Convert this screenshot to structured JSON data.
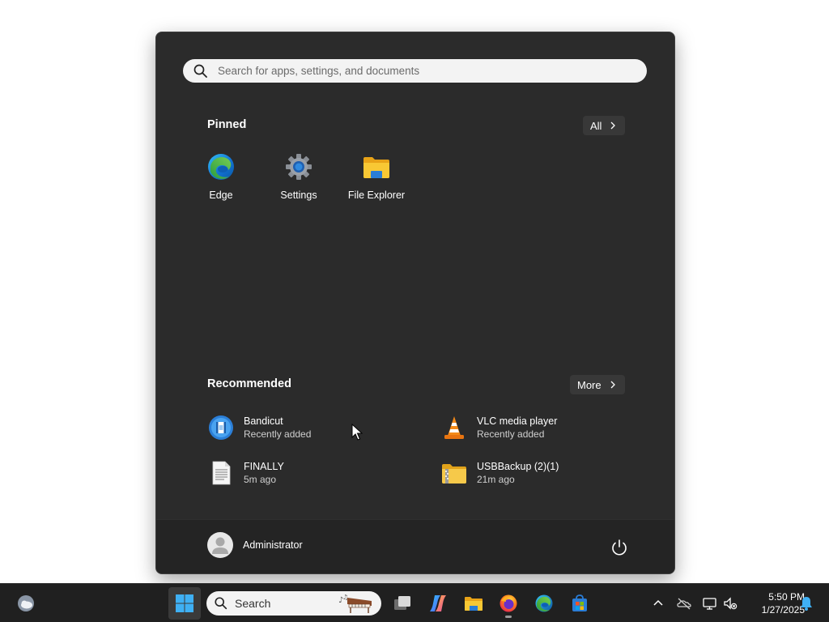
{
  "start_menu": {
    "search": {
      "placeholder": "Search for apps, settings, and documents"
    },
    "pinned": {
      "title": "Pinned",
      "all_button": "All",
      "apps": [
        {
          "label": "Edge",
          "icon": "edge-icon"
        },
        {
          "label": "Settings",
          "icon": "settings-gear-icon"
        },
        {
          "label": "File Explorer",
          "icon": "folder-icon"
        }
      ]
    },
    "recommended": {
      "title": "Recommended",
      "more_button": "More",
      "items": [
        {
          "title": "Bandicut",
          "subtitle": "Recently added",
          "icon": "bandicut-icon"
        },
        {
          "title": "VLC media player",
          "subtitle": "Recently added",
          "icon": "vlc-cone-icon"
        },
        {
          "title": "FINALLY",
          "subtitle": "5m ago",
          "icon": "text-document-icon"
        },
        {
          "title": "USBBackup (2)(1)",
          "subtitle": "21m ago",
          "icon": "zip-folder-icon"
        }
      ]
    },
    "footer": {
      "user_name": "Administrator"
    }
  },
  "taskbar": {
    "search_label": "Search",
    "clock": {
      "time": "5:50 PM",
      "date": "1/27/2025"
    }
  },
  "colors": {
    "menu_bg": "#2b2b2b",
    "footer_bg": "#242424",
    "taskbar_bg": "#202020",
    "accent_blue": "#0078d4",
    "folder_yellow": "#f5c338"
  }
}
